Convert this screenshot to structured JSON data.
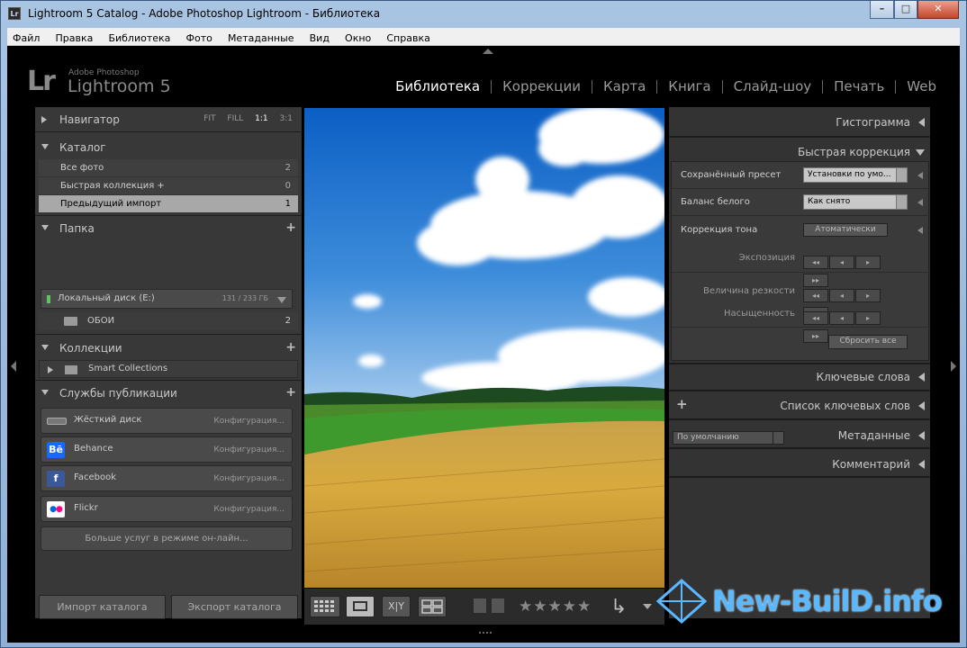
{
  "window": {
    "title": "Lightroom 5 Catalog - Adobe Photoshop Lightroom - Библиотека",
    "app_icon": "Lr"
  },
  "menu": [
    "Файл",
    "Правка",
    "Библиотека",
    "Фото",
    "Метаданные",
    "Вид",
    "Окно",
    "Справка"
  ],
  "logo": {
    "mark": "Lr",
    "small": "Adobe Photoshop",
    "large": "Lightroom 5"
  },
  "modules": [
    {
      "label": "Библиотека",
      "active": true
    },
    {
      "label": "Коррекции"
    },
    {
      "label": "Карта"
    },
    {
      "label": "Книга"
    },
    {
      "label": "Слайд-шоу"
    },
    {
      "label": "Печать"
    },
    {
      "label": "Web"
    }
  ],
  "left": {
    "navigator": {
      "title": "Навигатор",
      "zoom": [
        "FIT",
        "FILL",
        "1:1",
        "3:1"
      ],
      "zoom_active": "1:1"
    },
    "catalog": {
      "title": "Каталог",
      "items": [
        {
          "label": "Все фото",
          "count": "2"
        },
        {
          "label": "Быстрая коллекция +",
          "count": "0"
        },
        {
          "label": "Предыдущий импорт",
          "count": "1",
          "selected": true
        }
      ]
    },
    "folders": {
      "title": "Папка",
      "disk": "Локальный диск (E:)",
      "disk_size": "131 / 233 ГБ",
      "folder": "ОБОИ",
      "folder_count": "2"
    },
    "collections": {
      "title": "Коллекции",
      "smart": "Smart Collections"
    },
    "publish": {
      "title": "Службы публикации",
      "services": [
        {
          "label": "Жёсткий диск",
          "action": "Конфигурация...",
          "icon": "hard-drive-icon"
        },
        {
          "label": "Behance",
          "action": "Конфигурация...",
          "icon": "behance-icon",
          "badge": "Bē"
        },
        {
          "label": "Facebook",
          "action": "Конфигурация...",
          "icon": "facebook-icon",
          "badge": "f"
        },
        {
          "label": "Flickr",
          "action": "Конфигурация...",
          "icon": "flickr-icon",
          "badge": "●●"
        }
      ],
      "more": "Больше услуг в режиме он-лайн..."
    },
    "import_btn": "Импорт каталога",
    "export_btn": "Экспорт каталога"
  },
  "right": {
    "histogram": "Гистограмма",
    "quick_develop": {
      "title": "Быстрая коррекция",
      "preset_label": "Сохранённый пресет",
      "preset_value": "Установки по умо...",
      "wb_label": "Баланс белого",
      "wb_value": "Как снято",
      "tone_label": "Коррекция тона",
      "auto_btn": "Атоматически",
      "exposure": "Экспозиция",
      "clarity": "Величина резкости",
      "vibrance": "Насыщенность",
      "reset_btn": "Сбросить все"
    },
    "keywording": "Ключевые слова",
    "keyword_list": "Список ключевых слов",
    "metadata": "Метаданные",
    "metadata_preset": "По умолчанию",
    "comments": "Комментарий"
  },
  "watermark": "New-BuilD.info"
}
